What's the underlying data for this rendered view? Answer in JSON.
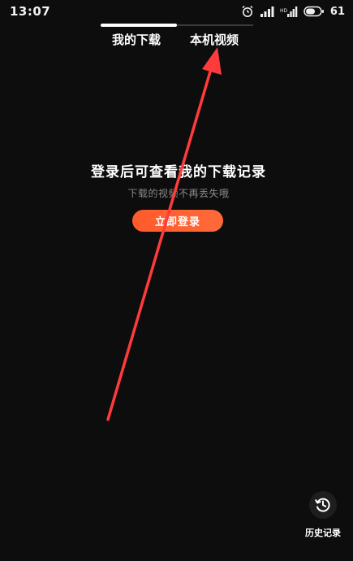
{
  "status_bar": {
    "time": "13:07",
    "battery": "61",
    "icons": [
      "alarm-icon",
      "signal-icon",
      "signal-hd-icon",
      "battery-icon"
    ]
  },
  "tabs": [
    {
      "label": "我的下载",
      "active": true
    },
    {
      "label": "本机视频",
      "active": false
    }
  ],
  "empty_state": {
    "title": "登录后可查看我的下载记录",
    "subtitle": "下载的视频不再丢失哦",
    "login_button": "立即登录"
  },
  "history": {
    "label": "历史记录",
    "icon": "history-clock-icon"
  },
  "colors": {
    "background": "#0d0d0d",
    "accent": "#ff5a2c",
    "annotation": "#ff3b3b"
  }
}
